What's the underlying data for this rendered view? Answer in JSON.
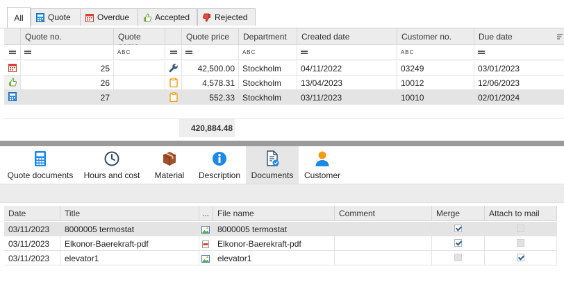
{
  "tabs": [
    {
      "label": "All",
      "icon": "none",
      "active": true
    },
    {
      "label": "Quote",
      "icon": "calculator-icon"
    },
    {
      "label": "Overdue",
      "icon": "calendar-icon"
    },
    {
      "label": "Accepted",
      "icon": "thumbs-up-icon"
    },
    {
      "label": "Rejected",
      "icon": "thumbs-down-icon"
    }
  ],
  "quotes": {
    "columns": [
      "Quote no.",
      "Quote name",
      "Quote price",
      "Department",
      "Created date",
      "Customer no.",
      "Due date"
    ],
    "rows": [
      {
        "status_icon": "calendar-icon",
        "quote_no": "25",
        "quote_name": "",
        "type_icon": "wrench-icon",
        "price": "42,500.00",
        "department": "Stockholm",
        "created": "04/11/2022",
        "customer": "03249",
        "due": "03/01/2023"
      },
      {
        "status_icon": "thumbs-up-icon",
        "quote_no": "26",
        "quote_name": "",
        "type_icon": "clipboard-icon",
        "price": "4,578.31",
        "department": "Stockholm",
        "created": "13/04/2023",
        "customer": "10012",
        "due": "12/06/2023"
      },
      {
        "status_icon": "calculator-icon",
        "quote_no": "27",
        "quote_name": "",
        "type_icon": "clipboard-icon",
        "price": "552.33",
        "department": "Stockholm",
        "created": "03/11/2023",
        "customer": "10010",
        "due": "02/01/2024"
      }
    ],
    "total_price": "420,884.48"
  },
  "tools": [
    {
      "label": "Quote documents",
      "icon": "calculator-icon"
    },
    {
      "label": "Hours and cost",
      "icon": "clock-icon"
    },
    {
      "label": "Material",
      "icon": "box-icon"
    },
    {
      "label": "Description",
      "icon": "info-icon"
    },
    {
      "label": "Documents",
      "icon": "documents-icon",
      "active": true
    },
    {
      "label": "Customer",
      "icon": "person-icon"
    }
  ],
  "documents": {
    "columns": [
      "Date",
      "Title",
      "...",
      "File name",
      "Comment",
      "Merge",
      "Attach to mail"
    ],
    "rows": [
      {
        "date": "03/11/2023",
        "title": "8000005 termostat",
        "file_icon": "image-icon",
        "file_name": "8000005 termostat",
        "comment": "",
        "merge": true,
        "attach": false,
        "attach_disabled": true
      },
      {
        "date": "03/11/2023",
        "title": "Elkonor-Baerekraft-pdf",
        "file_icon": "pdf-icon",
        "file_name": "Elkonor-Baerekraft-pdf",
        "comment": "",
        "merge": true,
        "attach": false,
        "attach_disabled": true
      },
      {
        "date": "03/11/2023",
        "title": "elevator1",
        "file_icon": "image-icon",
        "file_name": "elevator1",
        "comment": "",
        "merge": false,
        "merge_disabled": true,
        "attach": true
      }
    ]
  },
  "colors": {
    "accent_blue": "#1e88e5",
    "splitter": "#9b9b9b",
    "header_bg": "#ececec"
  }
}
